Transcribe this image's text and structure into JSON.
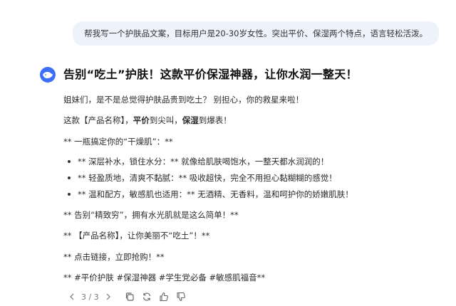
{
  "user_message": "帮我写一个护肤品文案，目标用户是20-30岁女性。突出平价、保湿两个特点，语言轻松活泼。",
  "answer": {
    "title": "告别“吃土”护肤！这款平价保湿神器，让你水润一整天！",
    "p1": "姐妹们，是不是总觉得护肤品贵到吃土？ 别担心，你的救星来啦！",
    "p2": {
      "a": "这款【产品名称】，",
      "b": "平价",
      "c": "到尖叫，",
      "d": "保湿",
      "e": "到爆表！"
    },
    "p3": "** 一瓶搞定你的“干燥肌”：**",
    "bullets": [
      "** 深层补水，锁住水分：** 就像给肌肤喝饱水，一整天都水润润的！",
      "** 轻盈质地，清爽不黏腻：** 吸收超快，完全不用担心黏糊糊的感觉！",
      "** 温和配方，敏感肌也适用：** 无酒精、无香料，温和呵护你的娇嫩肌肤！"
    ],
    "p4": "** 告别“精致穷”，拥有水光肌就是这么简单！**",
    "p5": "** 【产品名称】，让你美丽不“吃土”！**",
    "p6": "** 点击链接，立即抢购！**",
    "p7": "** #平价护肤 #保湿神器 #学生党必备 #敏感肌福音**"
  },
  "toolbar": {
    "pager": "3 / 3"
  },
  "icons": {
    "avatar": "assistant-whale-icon",
    "prev": "chevron-left-icon",
    "next": "chevron-right-icon",
    "copy": "copy-icon",
    "regenerate": "refresh-icon",
    "like": "thumbs-up-icon",
    "dislike": "thumbs-down-icon"
  },
  "colors": {
    "accent": "#3d6ef7",
    "bubble": "#eef2fb"
  }
}
